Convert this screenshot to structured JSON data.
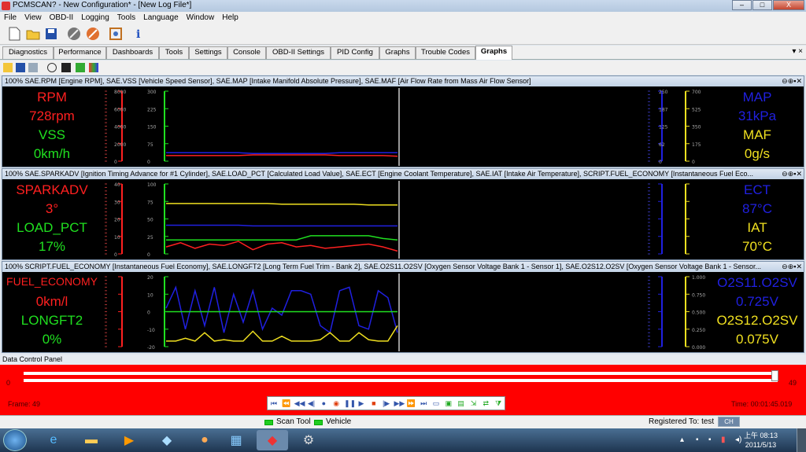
{
  "window": {
    "title": "PCMSCAN? - New Configuration* - [New Log File*]",
    "min": "–",
    "max": "□",
    "close": "X"
  },
  "menu": [
    "File",
    "View",
    "OBD-II",
    "Logging",
    "Tools",
    "Language",
    "Window",
    "Help"
  ],
  "toolbar_icons": [
    "new-file-icon",
    "open-folder-icon",
    "save-icon",
    "connect-icon",
    "disconnect-icon",
    "settings-icon",
    "info-icon"
  ],
  "tabs": [
    "Diagnostics",
    "Performance",
    "Dashboards",
    "Tools",
    "Settings",
    "Console",
    "OBD-II Settings",
    "PID Config",
    "Graphs",
    "Trouble Codes",
    "Graphs"
  ],
  "active_tab_index": 10,
  "tab_close": "▾ ×",
  "panels": [
    {
      "header": "100% SAE.RPM [Engine RPM], SAE.VSS [Vehicle Speed Sensor], SAE.MAP [Intake Manifold Absolute Pressure], SAE.MAF [Air Flow Rate from Mass Air Flow Sensor]",
      "left": [
        {
          "name": "RPM",
          "value": "728rpm",
          "color": "#ff2020"
        },
        {
          "name": "VSS",
          "value": "0km/h",
          "color": "#20e020"
        }
      ],
      "right": [
        {
          "name": "MAP",
          "value": "31kPa",
          "color": "#2020e0"
        },
        {
          "name": "MAF",
          "value": "0g/s",
          "color": "#f0e020"
        }
      ],
      "axis_l1": {
        "color": "#ff2020",
        "ticks": [
          "8000",
          "6000",
          "4000",
          "2000",
          "0"
        ]
      },
      "axis_l2": {
        "color": "#20e020",
        "ticks": [
          "300",
          "225",
          "150",
          "75",
          "0"
        ]
      },
      "axis_r1": {
        "color": "#2020e0",
        "ticks": [
          "250",
          "187",
          "125",
          "62",
          "0"
        ]
      },
      "axis_r2": {
        "color": "#f0e020",
        "ticks": [
          "700",
          "525",
          "350",
          "175",
          "0"
        ]
      },
      "series": [
        {
          "color": "#ff2020",
          "y": [
            0.08,
            0.08,
            0.08,
            0.08,
            0.08,
            0.08,
            0.09,
            0.09,
            0.09,
            0.09,
            0.09,
            0.09,
            0.08,
            0.08,
            0.08,
            0.08,
            0.07
          ]
        },
        {
          "color": "#2020e0",
          "y": [
            0.12,
            0.12,
            0.12,
            0.12,
            0.12,
            0.12,
            0.11,
            0.11,
            0.11,
            0.11,
            0.11,
            0.11,
            0.12,
            0.12,
            0.12,
            0.12,
            0.12
          ]
        }
      ]
    },
    {
      "header": "100% SAE.SPARKADV [Ignition Timing Advance for #1 Cylinder], SAE.LOAD_PCT [Calculated Load Value], SAE.ECT [Engine Coolant Temperature], SAE.IAT [Intake Air Temperature], SCRIPT.FUEL_ECONOMY [Instantaneous Fuel Eco...",
      "left": [
        {
          "name": "SPARKADV",
          "value": "3°",
          "color": "#ff2020"
        },
        {
          "name": "LOAD_PCT",
          "value": "17%",
          "color": "#20e020"
        }
      ],
      "right": [
        {
          "name": "ECT",
          "value": "87°C",
          "color": "#2020e0"
        },
        {
          "name": "IAT",
          "value": "70°C",
          "color": "#f0e020"
        }
      ],
      "axis_l1": {
        "color": "#ff2020",
        "ticks": [
          "40",
          "30",
          "20",
          "10",
          "0"
        ]
      },
      "axis_l2": {
        "color": "#20e020",
        "ticks": [
          "100",
          "75",
          "50",
          "25",
          "0"
        ]
      },
      "axis_r1": {
        "color": "#2020e0",
        "ticks": [
          "",
          "",
          "",
          "",
          ""
        ]
      },
      "axis_r2": {
        "color": "#f0e020",
        "ticks": [
          "",
          "",
          "",
          "",
          ""
        ]
      },
      "series": [
        {
          "color": "#f0e020",
          "y": [
            0.72,
            0.72,
            0.72,
            0.72,
            0.72,
            0.72,
            0.72,
            0.72,
            0.71,
            0.71,
            0.71,
            0.71,
            0.71,
            0.71,
            0.7,
            0.7,
            0.7
          ]
        },
        {
          "color": "#2020e0",
          "y": [
            0.41,
            0.41,
            0.41,
            0.41,
            0.41,
            0.41,
            0.4,
            0.4,
            0.4,
            0.4,
            0.4,
            0.4,
            0.4,
            0.4,
            0.4,
            0.4,
            0.4
          ]
        },
        {
          "color": "#20e020",
          "y": [
            0.2,
            0.2,
            0.2,
            0.2,
            0.2,
            0.2,
            0.2,
            0.2,
            0.2,
            0.2,
            0.26,
            0.26,
            0.26,
            0.26,
            0.26,
            0.22,
            0.2
          ]
        },
        {
          "color": "#ff2020",
          "y": [
            0.1,
            0.16,
            0.08,
            0.14,
            0.12,
            0.18,
            0.06,
            0.14,
            0.16,
            0.1,
            0.12,
            0.08,
            0.1,
            0.12,
            0.14,
            0.1,
            0.04
          ]
        }
      ]
    },
    {
      "header": "100% SCRIPT.FUEL_ECONOMY [Instantaneous Fuel Economy], SAE.LONGFT2 [Long Term Fuel Trim - Bank 2], SAE.O2S11.O2SV [Oxygen Sensor Voltage Bank 1 - Sensor 1], SAE.O2S12.O2SV [Oxygen Sensor Voltage Bank 1 - Sensor...",
      "left": [
        {
          "name": "FUEL_ECONOMY",
          "value": "0km/l",
          "color": "#ff2020"
        },
        {
          "name": "LONGFT2",
          "value": "0%",
          "color": "#20e020"
        }
      ],
      "right": [
        {
          "name": "O2S11.O2SV",
          "value": "0.725V",
          "color": "#2020e0"
        },
        {
          "name": "O2S12.O2SV",
          "value": "0.075V",
          "color": "#f0e020"
        }
      ],
      "axis_l1": {
        "color": "#ff2020",
        "ticks": [
          "",
          "",
          "",
          "",
          ""
        ]
      },
      "axis_l2": {
        "color": "#20e020",
        "ticks": [
          "20",
          "10",
          "0",
          "-10",
          "-20"
        ]
      },
      "axis_r1": {
        "color": "#2020e0",
        "ticks": [
          "",
          "",
          "",
          "",
          ""
        ]
      },
      "axis_r2": {
        "color": "#f0e020",
        "ticks": [
          "1.000",
          "0.750",
          "0.500",
          "0.250",
          "0.000"
        ]
      },
      "series": [
        {
          "color": "#2020e0",
          "y": [
            0.55,
            0.85,
            0.25,
            0.8,
            0.3,
            0.85,
            0.2,
            0.75,
            0.35,
            0.8,
            0.25,
            0.55,
            0.45,
            0.8,
            0.8,
            0.75,
            0.3,
            0.2,
            0.8,
            0.85,
            0.3,
            0.25,
            0.8,
            0.7,
            0.2
          ]
        },
        {
          "color": "#20e020",
          "y": [
            0.5,
            0.5,
            0.5,
            0.5,
            0.5,
            0.5,
            0.5,
            0.5,
            0.5,
            0.5,
            0.5,
            0.5,
            0.5,
            0.5,
            0.5,
            0.5,
            0.5,
            0.5,
            0.5,
            0.5,
            0.5,
            0.5,
            0.5,
            0.5,
            0.5
          ]
        },
        {
          "color": "#f0e020",
          "y": [
            0.08,
            0.08,
            0.12,
            0.08,
            0.2,
            0.08,
            0.1,
            0.08,
            0.08,
            0.22,
            0.08,
            0.08,
            0.15,
            0.08,
            0.08,
            0.08,
            0.1,
            0.2,
            0.08,
            0.08,
            0.2,
            0.1,
            0.08,
            0.08,
            0.3
          ]
        }
      ]
    }
  ],
  "data_control": {
    "title": "Data Control Panel",
    "min": "0",
    "max": "49",
    "frame": "Frame: 49",
    "time": "Time: 00:01:45.019",
    "position": 1.0
  },
  "status": {
    "scan_tool": "Scan Tool",
    "vehicle": "Vehicle",
    "registered": "Registered To: test"
  },
  "taskbar": {
    "lang": "CH",
    "time": "上午 08:13",
    "date": "2011/5/13"
  }
}
